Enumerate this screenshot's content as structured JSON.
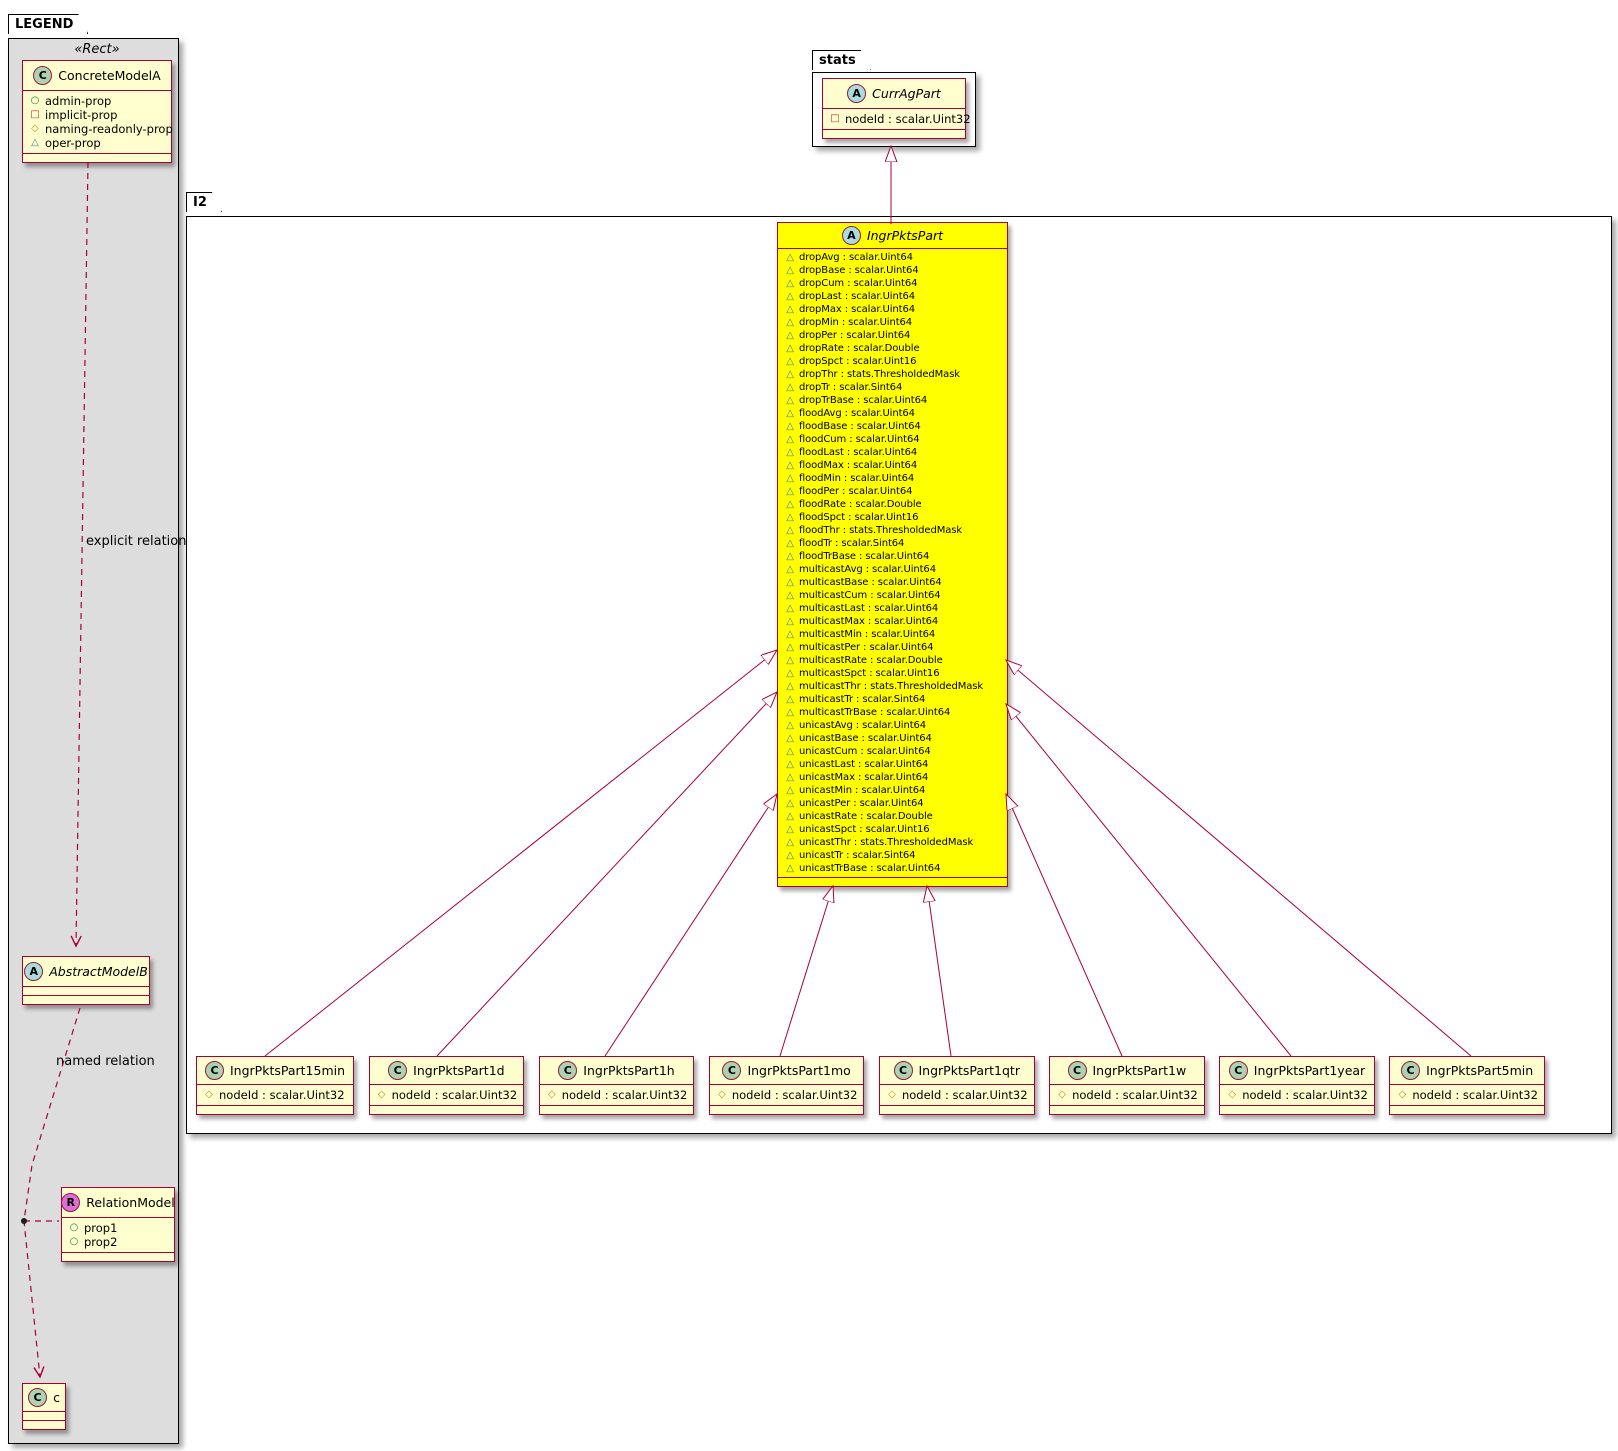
{
  "legend": {
    "title": "LEGEND",
    "stereotype": "«Rect»",
    "concrete_model": {
      "name": "ConcreteModelA",
      "spot": "C",
      "attrs": [
        {
          "icon": "circle",
          "label": "admin-prop"
        },
        {
          "icon": "square",
          "label": "implicit-prop"
        },
        {
          "icon": "diamond",
          "label": "naming-readonly-prop"
        },
        {
          "icon": "triangle",
          "label": "oper-prop"
        }
      ]
    },
    "relations": {
      "explicit": "explicit relation",
      "named": "named relation"
    },
    "abstract_model": {
      "name": "AbstractModelB",
      "spot": "A"
    },
    "relation_model": {
      "name": "RelationModel",
      "spot": "R",
      "attrs": [
        {
          "icon": "circle",
          "label": "prop1"
        },
        {
          "icon": "circle",
          "label": "prop2"
        }
      ]
    },
    "c_class": {
      "name": "c",
      "spot": "C"
    }
  },
  "stats_package": {
    "title": "stats",
    "curr_ag_part": {
      "name": "CurrAgPart",
      "spot": "A",
      "attrs": [
        {
          "icon": "square",
          "label": "nodeId : scalar.Uint32"
        }
      ]
    }
  },
  "i2_package": {
    "title": "I2",
    "main_class": {
      "name": "IngrPktsPart",
      "spot": "A",
      "attrs": [
        {
          "icon": "triangle",
          "label": "dropAvg : scalar.Uint64"
        },
        {
          "icon": "triangle",
          "label": "dropBase : scalar.Uint64"
        },
        {
          "icon": "triangle",
          "label": "dropCum : scalar.Uint64"
        },
        {
          "icon": "triangle",
          "label": "dropLast : scalar.Uint64"
        },
        {
          "icon": "triangle",
          "label": "dropMax : scalar.Uint64"
        },
        {
          "icon": "triangle",
          "label": "dropMin : scalar.Uint64"
        },
        {
          "icon": "triangle",
          "label": "dropPer : scalar.Uint64"
        },
        {
          "icon": "triangle",
          "label": "dropRate : scalar.Double"
        },
        {
          "icon": "triangle",
          "label": "dropSpct : scalar.Uint16"
        },
        {
          "icon": "triangle",
          "label": "dropThr : stats.ThresholdedMask"
        },
        {
          "icon": "triangle",
          "label": "dropTr : scalar.Sint64"
        },
        {
          "icon": "triangle",
          "label": "dropTrBase : scalar.Uint64"
        },
        {
          "icon": "triangle",
          "label": "floodAvg : scalar.Uint64"
        },
        {
          "icon": "triangle",
          "label": "floodBase : scalar.Uint64"
        },
        {
          "icon": "triangle",
          "label": "floodCum : scalar.Uint64"
        },
        {
          "icon": "triangle",
          "label": "floodLast : scalar.Uint64"
        },
        {
          "icon": "triangle",
          "label": "floodMax : scalar.Uint64"
        },
        {
          "icon": "triangle",
          "label": "floodMin : scalar.Uint64"
        },
        {
          "icon": "triangle",
          "label": "floodPer : scalar.Uint64"
        },
        {
          "icon": "triangle",
          "label": "floodRate : scalar.Double"
        },
        {
          "icon": "triangle",
          "label": "floodSpct : scalar.Uint16"
        },
        {
          "icon": "triangle",
          "label": "floodThr : stats.ThresholdedMask"
        },
        {
          "icon": "triangle",
          "label": "floodTr : scalar.Sint64"
        },
        {
          "icon": "triangle",
          "label": "floodTrBase : scalar.Uint64"
        },
        {
          "icon": "triangle",
          "label": "multicastAvg : scalar.Uint64"
        },
        {
          "icon": "triangle",
          "label": "multicastBase : scalar.Uint64"
        },
        {
          "icon": "triangle",
          "label": "multicastCum : scalar.Uint64"
        },
        {
          "icon": "triangle",
          "label": "multicastLast : scalar.Uint64"
        },
        {
          "icon": "triangle",
          "label": "multicastMax : scalar.Uint64"
        },
        {
          "icon": "triangle",
          "label": "multicastMin : scalar.Uint64"
        },
        {
          "icon": "triangle",
          "label": "multicastPer : scalar.Uint64"
        },
        {
          "icon": "triangle",
          "label": "multicastRate : scalar.Double"
        },
        {
          "icon": "triangle",
          "label": "multicastSpct : scalar.Uint16"
        },
        {
          "icon": "triangle",
          "label": "multicastThr : stats.ThresholdedMask"
        },
        {
          "icon": "triangle",
          "label": "multicastTr : scalar.Sint64"
        },
        {
          "icon": "triangle",
          "label": "multicastTrBase : scalar.Uint64"
        },
        {
          "icon": "triangle",
          "label": "unicastAvg : scalar.Uint64"
        },
        {
          "icon": "triangle",
          "label": "unicastBase : scalar.Uint64"
        },
        {
          "icon": "triangle",
          "label": "unicastCum : scalar.Uint64"
        },
        {
          "icon": "triangle",
          "label": "unicastLast : scalar.Uint64"
        },
        {
          "icon": "triangle",
          "label": "unicastMax : scalar.Uint64"
        },
        {
          "icon": "triangle",
          "label": "unicastMin : scalar.Uint64"
        },
        {
          "icon": "triangle",
          "label": "unicastPer : scalar.Uint64"
        },
        {
          "icon": "triangle",
          "label": "unicastRate : scalar.Double"
        },
        {
          "icon": "triangle",
          "label": "unicastSpct : scalar.Uint16"
        },
        {
          "icon": "triangle",
          "label": "unicastThr : stats.ThresholdedMask"
        },
        {
          "icon": "triangle",
          "label": "unicastTr : scalar.Sint64"
        },
        {
          "icon": "triangle",
          "label": "unicastTrBase : scalar.Uint64"
        }
      ]
    },
    "children": [
      {
        "name": "IngrPktsPart15min",
        "spot": "C",
        "attr_icon": "diamond",
        "attr": "nodeId : scalar.Uint32"
      },
      {
        "name": "IngrPktsPart1d",
        "spot": "C",
        "attr_icon": "diamond",
        "attr": "nodeId : scalar.Uint32"
      },
      {
        "name": "IngrPktsPart1h",
        "spot": "C",
        "attr_icon": "diamond",
        "attr": "nodeId : scalar.Uint32"
      },
      {
        "name": "IngrPktsPart1mo",
        "spot": "C",
        "attr_icon": "diamond",
        "attr": "nodeId : scalar.Uint32"
      },
      {
        "name": "IngrPktsPart1qtr",
        "spot": "C",
        "attr_icon": "diamond",
        "attr": "nodeId : scalar.Uint32"
      },
      {
        "name": "IngrPktsPart1w",
        "spot": "C",
        "attr_icon": "diamond",
        "attr": "nodeId : scalar.Uint32"
      },
      {
        "name": "IngrPktsPart1year",
        "spot": "C",
        "attr_icon": "diamond",
        "attr": "nodeId : scalar.Uint32"
      },
      {
        "name": "IngrPktsPart5min",
        "spot": "C",
        "attr_icon": "diamond",
        "attr": "nodeId : scalar.Uint32"
      }
    ]
  },
  "colors": {
    "class_border": "#A80036",
    "class_fill": "#FEFECE",
    "highlight_fill": "#FFFF00",
    "legend_bg": "#DDDDDD",
    "spot_class": "#ADD1B2",
    "spot_abstract": "#A9DCDF",
    "spot_relation": "#DA70D6",
    "icon_circle": "#128642",
    "icon_square": "#C82930",
    "icon_diamond": "#C09222",
    "icon_triangle": "#4579A8"
  }
}
